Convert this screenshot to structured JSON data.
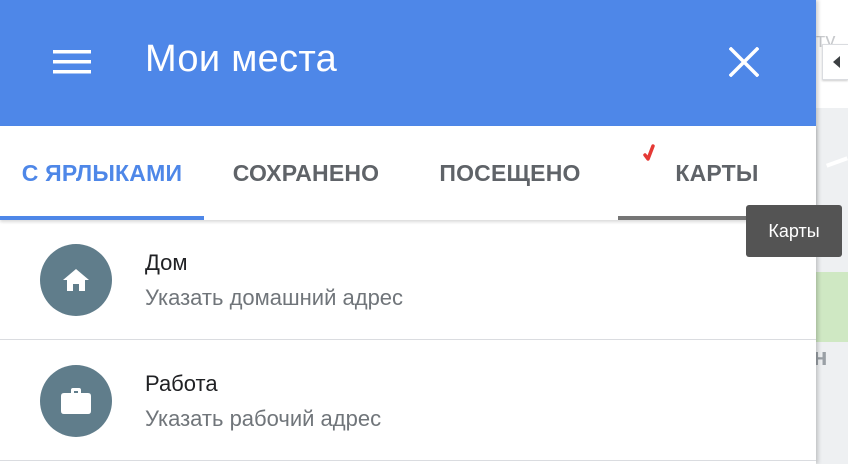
{
  "header": {
    "title": "Мои места",
    "background_color": "#4e87e8",
    "menu_icon": "hamburger-menu-icon",
    "close_icon": "close-icon"
  },
  "tabs": [
    {
      "label": "С ЯРЛЫКАМИ",
      "active": true
    },
    {
      "label": "СОХРАНЕНО",
      "active": false
    },
    {
      "label": "ПОСЕЩЕНО",
      "active": false
    },
    {
      "label": "КАРТЫ",
      "active": false,
      "hovered": true
    }
  ],
  "tooltip": {
    "text": "Карты"
  },
  "items": [
    {
      "title": "Дом",
      "subtitle": "Указать домашний адрес",
      "icon": "home-icon"
    },
    {
      "title": "Работа",
      "subtitle": "Указать рабочий адрес",
      "icon": "briefcase-icon"
    }
  ],
  "colors": {
    "accent": "#4e87e8",
    "icon_circle": "#607d8b",
    "hover_underline": "#757575"
  }
}
